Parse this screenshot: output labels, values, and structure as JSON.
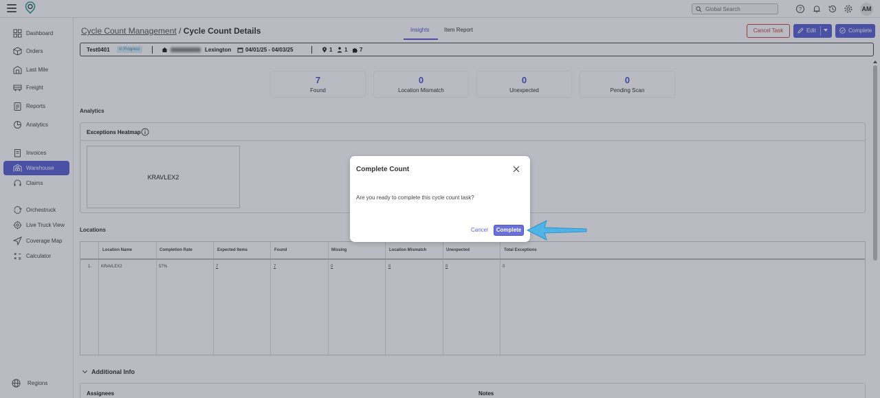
{
  "header": {
    "search_placeholder": "Global Search",
    "avatar_initials": "AM"
  },
  "sidebar": {
    "items": [
      {
        "label": "Dashboard",
        "icon": "dashboard-icon"
      },
      {
        "label": "Orders",
        "icon": "box-icon"
      },
      {
        "label": "Last Mile",
        "icon": "delivery-icon"
      },
      {
        "label": "Freight",
        "icon": "truck-icon"
      },
      {
        "label": "Reports",
        "icon": "reports-icon"
      },
      {
        "label": "Analytics",
        "icon": "analytics-icon"
      },
      {
        "label": "Invoices",
        "icon": "invoice-icon"
      },
      {
        "label": "Warehouse",
        "icon": "warehouse-icon",
        "active": true
      },
      {
        "label": "Claims",
        "icon": "headset-icon"
      },
      {
        "label": "Orchestruck",
        "icon": "orchestruck-icon"
      },
      {
        "label": "Live Truck View",
        "icon": "live-view-icon"
      },
      {
        "label": "Coverage Map",
        "icon": "map-pointer-icon"
      },
      {
        "label": "Calculator",
        "icon": "calculator-icon"
      },
      {
        "label": "Regions",
        "icon": "globe-icon"
      }
    ]
  },
  "breadcrumb": {
    "parent": "Cycle Count Management",
    "separator": "/",
    "current": "Cycle Count Details"
  },
  "tabs": [
    {
      "label": "Insights",
      "active": true
    },
    {
      "label": "Item Report",
      "active": false
    }
  ],
  "actions": {
    "cancel_task": "Cancel Task",
    "edit": "Edit",
    "complete": "Complete"
  },
  "task": {
    "name": "Test0401",
    "status": "In Progress",
    "city": "Lexington",
    "date_range": "04/01/25 - 04/03/25",
    "locations_count": "1",
    "assignees_count": "1",
    "items_count": "7"
  },
  "stats": [
    {
      "value": "7",
      "label": "Found"
    },
    {
      "value": "0",
      "label": "Location Mismatch"
    },
    {
      "value": "0",
      "label": "Unexpected"
    },
    {
      "value": "0",
      "label": "Pending Scan"
    }
  ],
  "analytics": {
    "title": "Analytics",
    "heatmap_title": "Exceptions Heatmap",
    "heatmap_cell": "KRAVLEX2"
  },
  "locations": {
    "title": "Locations",
    "columns": [
      "Location Name",
      "Completion Rate",
      "Expected Items",
      "Found",
      "Missing",
      "Location Mismatch",
      "Unexpected",
      "Total Exceptions"
    ],
    "rows": [
      {
        "index": "1.",
        "location_name": "KRAVLEX2",
        "completion_rate": "57%",
        "expected_items": "7",
        "found": "7",
        "missing": "0",
        "location_mismatch": "0",
        "unexpected": "0",
        "total_exceptions": "0"
      }
    ]
  },
  "additional_info": {
    "title": "Additional Info",
    "assignees": "Assignees",
    "notes": "Notes"
  },
  "modal": {
    "title": "Complete Count",
    "message": "Are you ready to complete this cycle count task?",
    "cancel": "Cancel",
    "confirm": "Complete"
  },
  "colors": {
    "accent": "#5b63d3",
    "danger": "#c5473e",
    "arrow": "#4fb3e6"
  }
}
